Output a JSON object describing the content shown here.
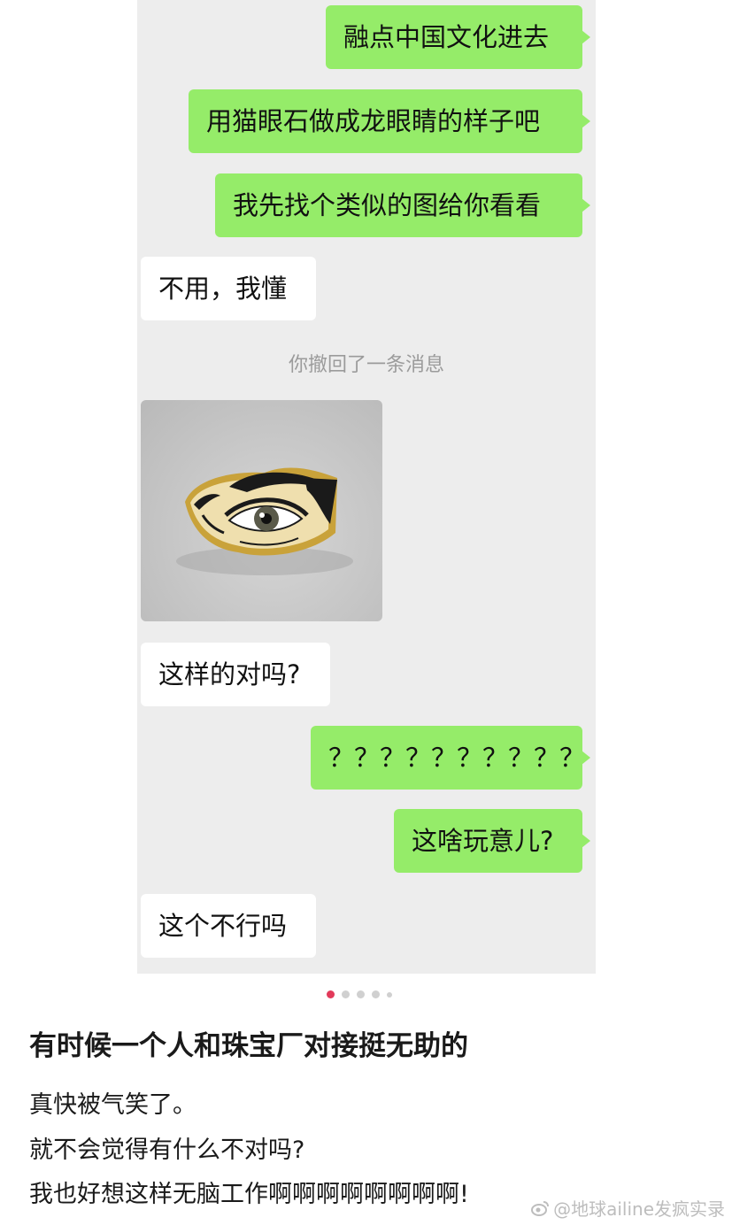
{
  "chat": {
    "messages": [
      {
        "side": "out",
        "text": "融点中国文化进去"
      },
      {
        "side": "out",
        "text": "用猫眼石做成龙眼睛的样子吧"
      },
      {
        "side": "out",
        "text": "我先找个类似的图给你看看"
      },
      {
        "side": "in",
        "text": "不用，我懂"
      },
      {
        "side": "system",
        "text": "你撤回了一条消息"
      },
      {
        "side": "in",
        "type": "image",
        "icon": "eye-ring-photo"
      },
      {
        "side": "in",
        "text": "这样的对吗?"
      },
      {
        "side": "out",
        "text": "？？？？？？？？？？"
      },
      {
        "side": "out",
        "text": "这啥玩意儿?"
      },
      {
        "side": "in",
        "text": "这个不行吗"
      }
    ]
  },
  "carousel": {
    "count": 5,
    "active": 1
  },
  "post": {
    "title": "有时候一个人和珠宝厂对接挺无助的",
    "lines": [
      "真快被气笑了。",
      "就不会觉得有什么不对吗?",
      "我也好想这样无脑工作啊啊啊啊啊啊啊啊!"
    ]
  },
  "watermark": {
    "text": "@地球ailine发疯实录",
    "icon": "weibo-icon"
  },
  "colors": {
    "outgoing_bubble": "#95ec69",
    "incoming_bubble": "#ffffff",
    "chat_bg": "#ededed",
    "active_dot": "#e23a5a"
  }
}
